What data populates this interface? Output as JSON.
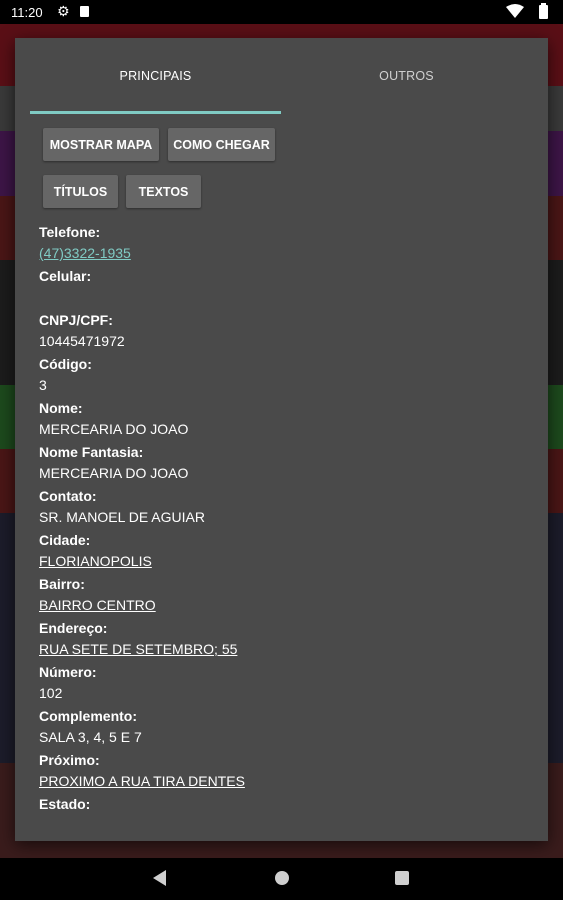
{
  "status_bar": {
    "time": "11:20",
    "icons": [
      "gear-icon",
      "sd-card-icon",
      "wifi-icon",
      "battery-icon"
    ]
  },
  "dialog": {
    "tabs": [
      {
        "label": "PRINCIPAIS",
        "active": true
      },
      {
        "label": "OUTROS",
        "active": false
      }
    ],
    "accent_color": "#80cbc4",
    "buttons": {
      "mostrar_mapa": "MOSTRAR MAPA",
      "como_chegar": "COMO CHEGAR",
      "titulos": "TÍTULOS",
      "textos": "TEXTOS"
    },
    "fields": {
      "telefone": {
        "label": "Telefone:",
        "value": "(47)3322-1935"
      },
      "celular": {
        "label": "Celular:",
        "value": ""
      },
      "cnpj": {
        "label": "CNPJ/CPF:",
        "value": "10445471972"
      },
      "codigo": {
        "label": "Código:",
        "value": "3"
      },
      "nome": {
        "label": "Nome:",
        "value": "MERCEARIA DO JOAO"
      },
      "nome_fantasia": {
        "label": "Nome Fantasia:",
        "value": "MERCEARIA DO JOAO"
      },
      "contato": {
        "label": "Contato:",
        "value": "SR. MANOEL DE AGUIAR"
      },
      "cidade": {
        "label": "Cidade:",
        "value": "FLORIANOPOLIS"
      },
      "bairro": {
        "label": "Bairro:",
        "value": "BAIRRO CENTRO"
      },
      "endereco": {
        "label": "Endereço:",
        "value": "RUA SETE DE SETEMBRO; 55"
      },
      "numero": {
        "label": "Número:",
        "value": "102"
      },
      "complemento": {
        "label": "Complemento:",
        "value": "SALA 3, 4, 5 E 7"
      },
      "proximo": {
        "label": "Próximo:",
        "value": "PROXIMO A RUA TIRA DENTES"
      },
      "estado": {
        "label": "Estado:",
        "value": ""
      }
    }
  },
  "nav_bar": {
    "icons": [
      "back-icon",
      "home-icon",
      "recents-icon"
    ]
  }
}
